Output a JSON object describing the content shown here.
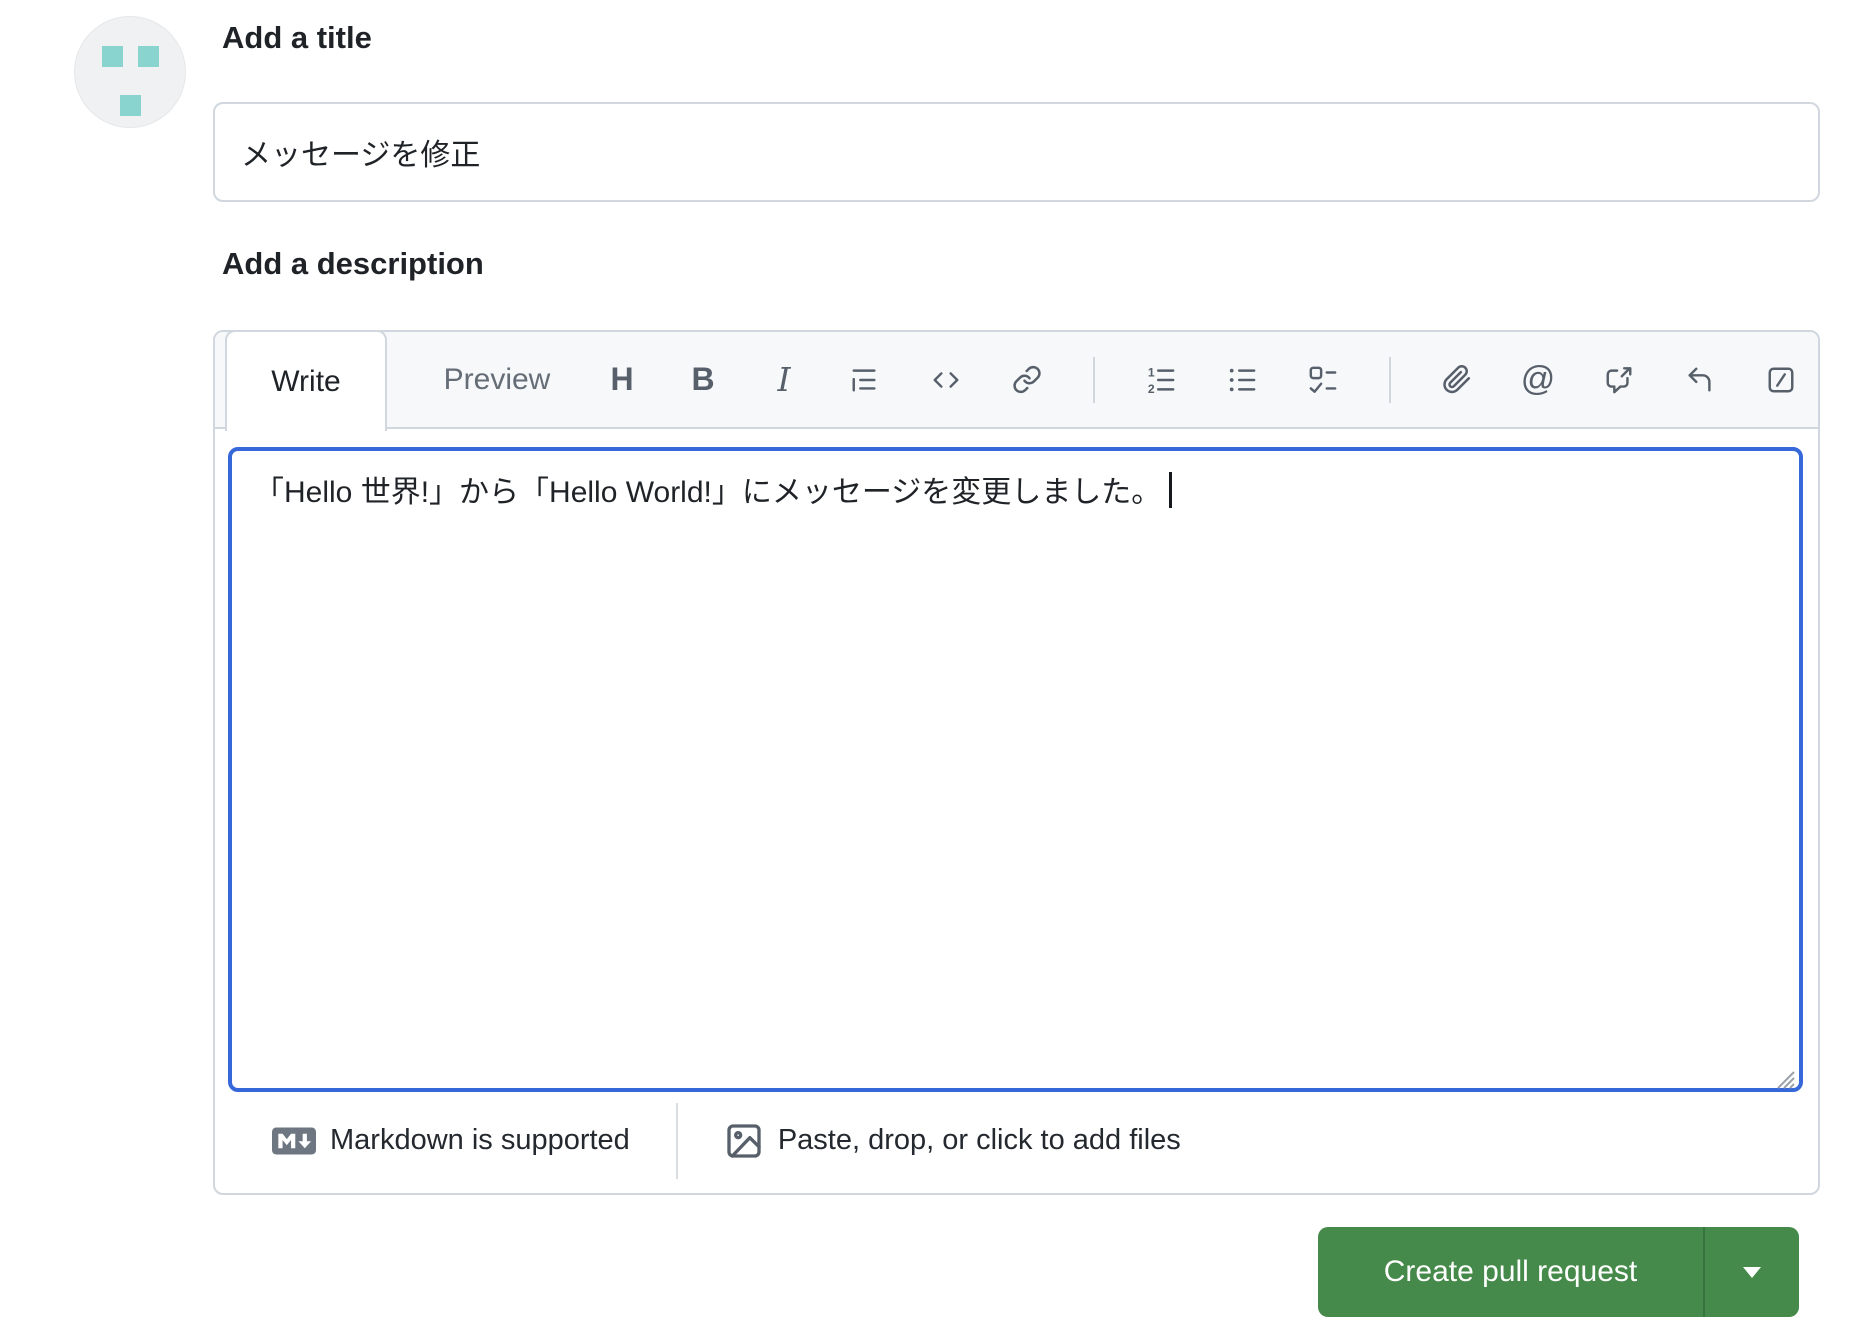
{
  "title_section": {
    "label": "Add a title",
    "value": "メッセージを修正"
  },
  "description_section": {
    "label": "Add a description"
  },
  "editor": {
    "tabs": [
      {
        "label": "Write",
        "active": true
      },
      {
        "label": "Preview",
        "active": false
      }
    ],
    "toolbar": {
      "icons": [
        "heading",
        "bold",
        "italic",
        "quote",
        "code",
        "link",
        "numbered-list",
        "bullet-list",
        "task-list",
        "attach-file",
        "mention",
        "cross-reference",
        "reply",
        "slash-command"
      ],
      "glyphs": {
        "heading": "H",
        "bold": "B",
        "italic": "I",
        "mention": "@"
      }
    },
    "body_text": "「Hello 世界!」から「Hello World!」にメッセージを変更しました。",
    "footer": {
      "markdown_label": "Markdown is supported",
      "attach_label": "Paste, drop, or click to add files"
    }
  },
  "actions": {
    "create_label": "Create pull request"
  },
  "colors": {
    "button_green": "#458a4a",
    "focus_border_blue": "#3668d9",
    "avatar_teal": "#8ad4cf",
    "border_gray": "#d0d7de",
    "toolbar_bg": "#f6f8fa",
    "icon_gray": "#57606a"
  }
}
